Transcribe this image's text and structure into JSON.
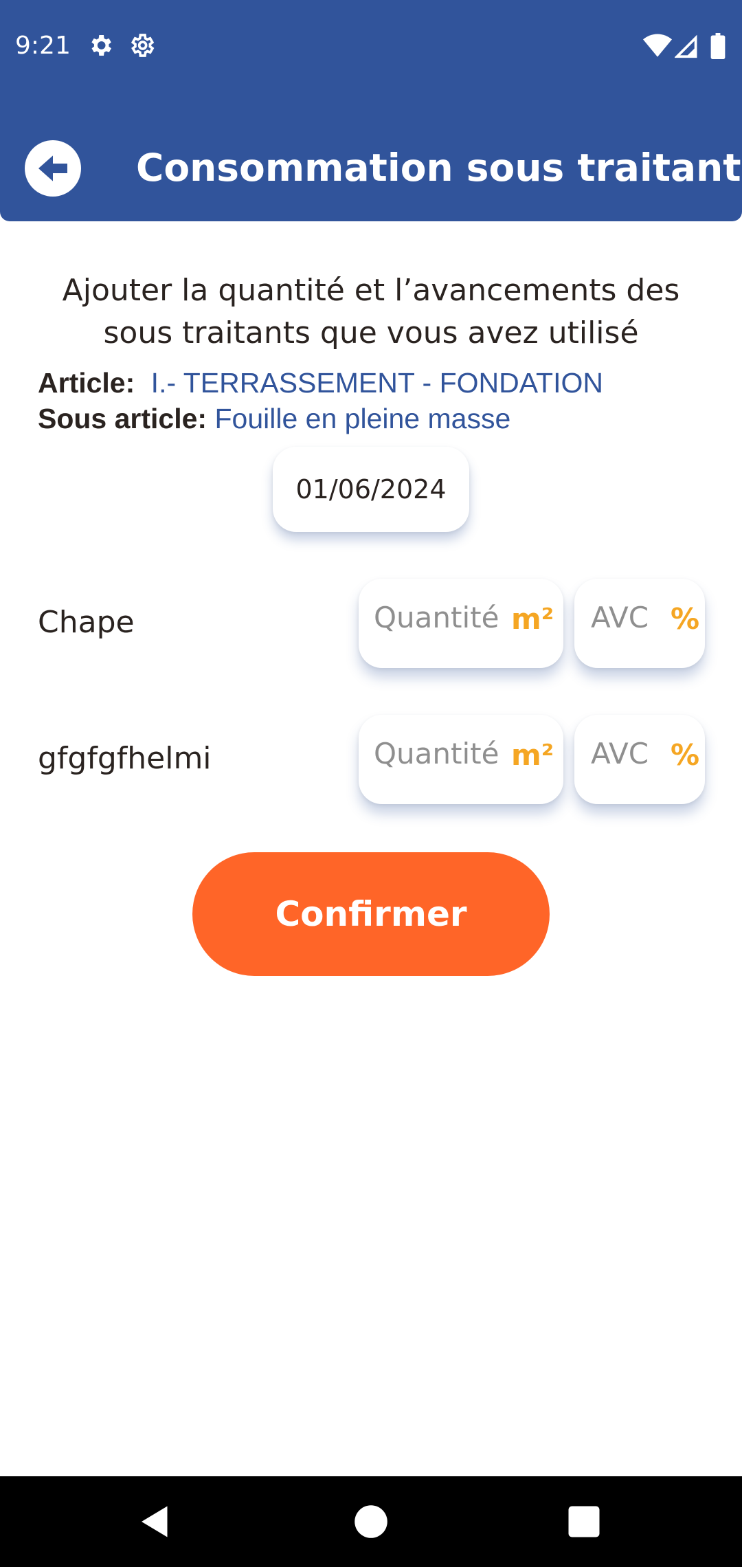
{
  "status_bar": {
    "time": "9:21",
    "icons": [
      "gear-icon",
      "settings-gear-icon",
      "wifi-icon",
      "signal-icon",
      "battery-icon"
    ]
  },
  "header": {
    "title": "Consommation sous traitants",
    "back_icon": "arrow-left-icon",
    "color": "#31549b"
  },
  "intro": {
    "text": "Ajouter la quantité et l’avancements des sous traitants que vous avez utilisé"
  },
  "article": {
    "label": "Article:",
    "value": "I.- TERRASSEMENT - FONDATION"
  },
  "sous_article": {
    "label": "Sous article:",
    "value": "Fouille en pleine masse"
  },
  "date": {
    "value": "01/06/2024"
  },
  "rows": [
    {
      "name": "Chape",
      "quantity_placeholder": "Quantité",
      "quantity_unit": "m²",
      "avc_placeholder": "AVC",
      "avc_unit": "%"
    },
    {
      "name": "gfgfgfhelmi",
      "quantity_placeholder": "Quantité",
      "quantity_unit": "m²",
      "avc_placeholder": "AVC",
      "avc_unit": "%"
    }
  ],
  "confirm_button": {
    "label": "Confirmer",
    "color": "#ff6528"
  },
  "unit_color": "#f5a623",
  "nav": {
    "icons": [
      "back-triangle-icon",
      "home-circle-icon",
      "recents-square-icon"
    ]
  }
}
